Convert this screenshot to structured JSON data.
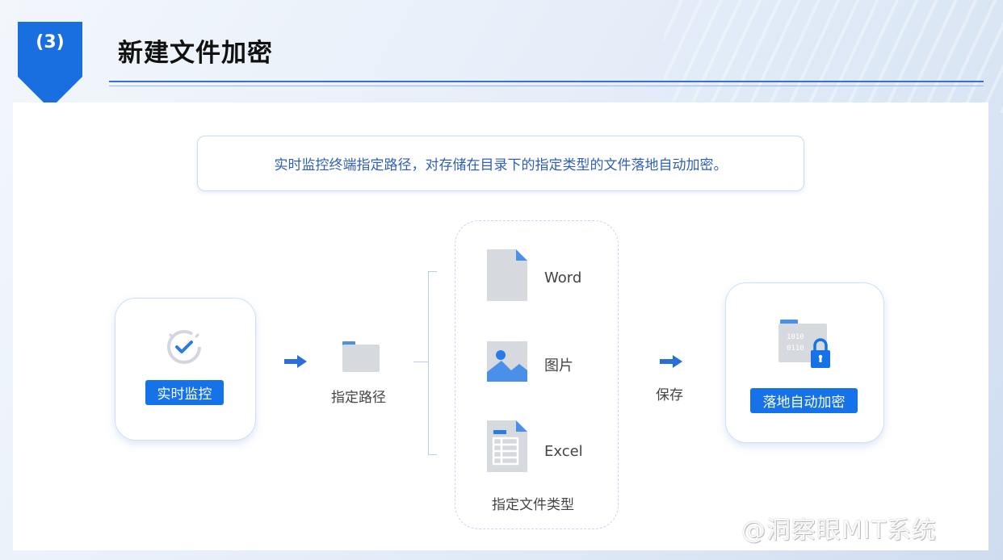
{
  "header": {
    "section_number": "(3)",
    "title": "新建文件加密"
  },
  "description": "实时监控终端指定路径，对存储在目录下的指定类型的文件落地自动加密。",
  "flow": {
    "monitor_tag": "实时监控",
    "path_label": "指定路径",
    "file_types": [
      {
        "label": "Word",
        "icon": "document-icon"
      },
      {
        "label": "图片",
        "icon": "image-icon"
      },
      {
        "label": "Excel",
        "icon": "spreadsheet-icon"
      }
    ],
    "file_types_caption": "指定文件类型",
    "save_label": "保存",
    "encrypt_tag": "落地自动加密"
  },
  "watermark": "@洞察眼MIT系统",
  "colors": {
    "accent": "#1572e8",
    "icon_grey": "#d6d9de",
    "icon_blue": "#4a90e8",
    "text_blue": "#2f5fb8"
  }
}
